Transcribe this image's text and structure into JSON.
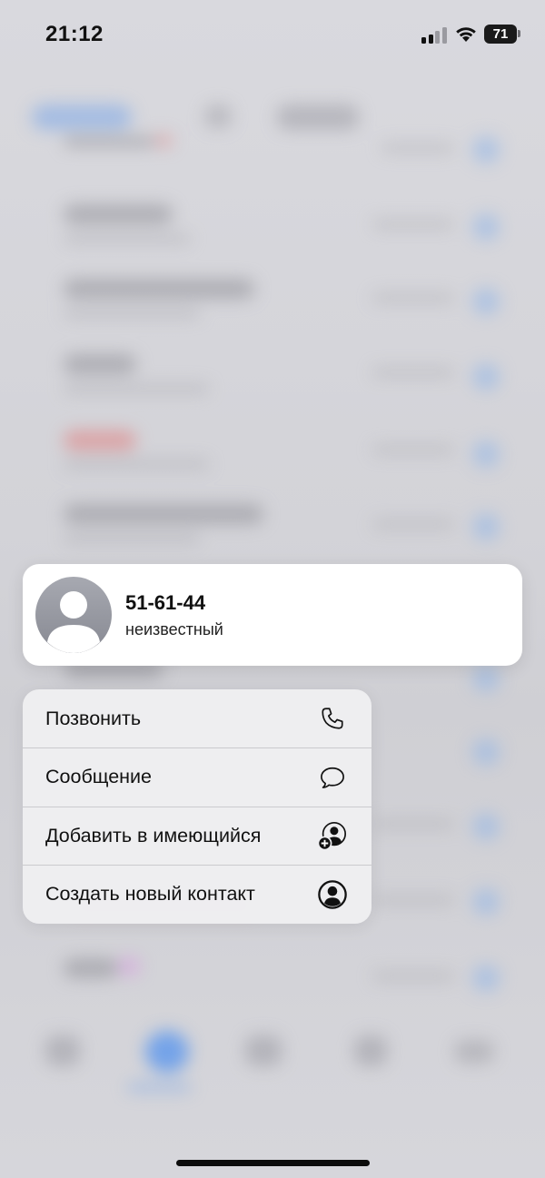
{
  "status_bar": {
    "time": "21:12",
    "battery_level": "71",
    "signal_bars_active": 2,
    "signal_bars_total": 4
  },
  "contact": {
    "number": "51-61-44",
    "label": "неизвестный",
    "avatar_icon": "person-placeholder-icon"
  },
  "menu": {
    "items": [
      {
        "label": "Позвонить",
        "icon": "phone-icon"
      },
      {
        "label": "Сообщение",
        "icon": "message-bubble-icon"
      },
      {
        "label": "Добавить в имеющийся",
        "icon": "add-to-contact-icon"
      },
      {
        "label": "Создать новый контакт",
        "icon": "person-circle-icon"
      }
    ]
  },
  "colors": {
    "text": "#111111",
    "card_background": "#ffffff",
    "menu_background": "#eeeef1",
    "avatar_gray": "#9a9ca4"
  }
}
